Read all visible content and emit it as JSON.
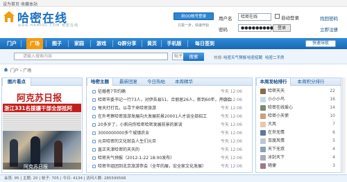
{
  "topbar": {
    "home": "设为首页",
    "fav": "收藏本站"
  },
  "logo": {
    "text": "哈密在线",
    "sub": "www.HAMIOL.COM 哈密在线"
  },
  "qq": {
    "button": "用QQ帐号登录",
    "note": "只需一步，快速开始"
  },
  "login": {
    "user_label": "用户名",
    "user_value": "哈密在线",
    "pass_label": "密码",
    "pass_value": "●●●●●●●●●●●●",
    "autologin": "自动登录",
    "forgot": "找回密码",
    "submit": "登录",
    "register": "立即注册"
  },
  "nav": {
    "items": [
      "门户",
      "广场",
      "图子",
      "家园",
      "游戏",
      "Q群分享",
      "黄页",
      "手机版",
      "每日签到"
    ],
    "right": "快速导航"
  },
  "search": {
    "placeholder": "请输入搜索内容",
    "type": "帖子",
    "button": "搜索",
    "hot_label": "热搜:",
    "hot_links": [
      "哈密天气预报",
      "哈密招聘",
      "哈密二手房"
    ]
  },
  "breadcrumb": "门户 › 广场",
  "left_panel": {
    "tab": "图片看点",
    "paper_title": "阿克苏日报",
    "headline": "浙江331名援疆干部全部抵阿",
    "caption": "阿克苏日报"
  },
  "center_panel": {
    "tabs": [
      "哈密主题",
      "最新回复",
      "今日热帖",
      "本周精华"
    ],
    "news": [
      {
        "title": "征婚者7节约确",
        "date": "今天 12:06"
      },
      {
        "title": "哈密市委书记一行73人，对伊吾县51、合丽居26人，新到60年，开会会",
        "date": "今天 12:06"
      },
      {
        "title": "每天打打瓦，以寻下来哈密旅游",
        "date": "今天 12:06"
      },
      {
        "title": "在外考察哈密旅游发展向大发展前景20001人才谈全部招工",
        "date": "今天 12:06"
      },
      {
        "title": "20多岁了，小莉向你哈密哈密发展前景的家谈",
        "date": "今天 12:06"
      },
      {
        "title": "3000000000多个城镇农业",
        "date": "今天 12:06"
      },
      {
        "title": "元旦哈密的文化就会人生们元旦",
        "date": "今天 12:06"
      },
      {
        "title": "直正天津哈密的天天的",
        "date": "今天 12:06"
      },
      {
        "title": "哈密天气预报（2012-1-22 18:00发布）",
        "date": "今天 12:06"
      },
      {
        "title": "哈密市组团到北京旅游参会（全年的展，宏全家文化发展）",
        "date": "今天 12:06"
      }
    ]
  },
  "right_panel": {
    "tabs": [
      "本周发帖排行",
      "本周积分排行"
    ],
    "ranks": [
      {
        "name": "哈密天天",
        "score": "22",
        "color": "#8a6a4a"
      },
      {
        "name": "小小小鸟",
        "score": "16",
        "color": "#c9d9e9"
      },
      {
        "name": "哈密在线爱心",
        "score": "14",
        "color": "#7a8a6a"
      },
      {
        "name": "哈密小天使",
        "score": "10",
        "color": "#caa07a"
      },
      {
        "name": "大风",
        "score": "7",
        "color": "#e9c9a9"
      },
      {
        "name": "在世无情",
        "score": "6",
        "color": "#5a7a9a"
      },
      {
        "name": "百度风情",
        "score": "5",
        "color": "#b9c9d9"
      },
      {
        "name": "天下无双",
        "score": "4",
        "color": "#8aa0b8"
      },
      {
        "name": "冰封天下",
        "score": "4",
        "color": "#aab"
      },
      {
        "name": "随便",
        "score": "3",
        "color": "#9a7a8a"
      }
    ]
  },
  "footer": {
    "text": "会员: 95  |  主题: 20  |  帖子: 705  |  今日: 4134  |  访问人数: 285599568"
  }
}
